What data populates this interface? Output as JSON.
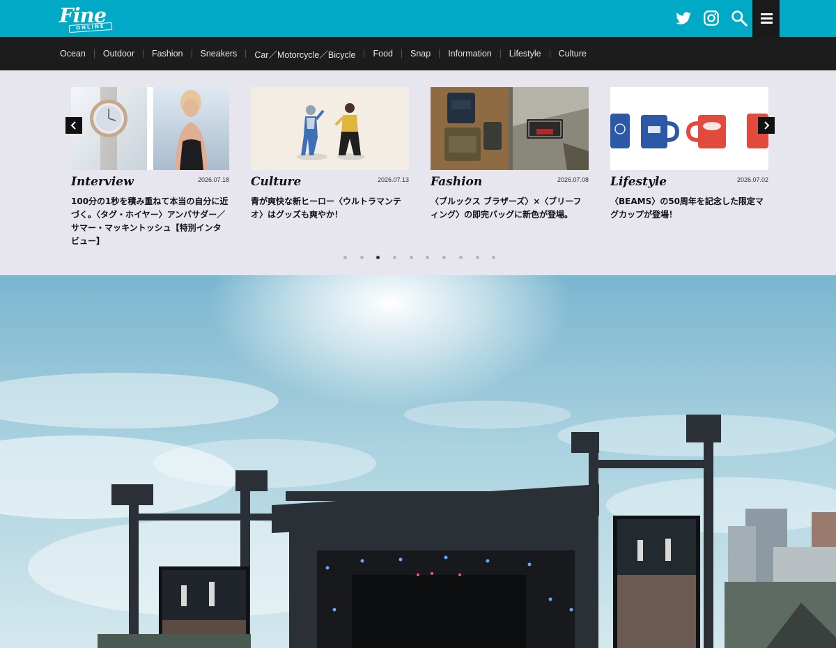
{
  "header": {
    "logo_text": "Fine",
    "logo_sub": "ONLINE",
    "icons": [
      "twitter-icon",
      "instagram-icon",
      "search-icon",
      "menu-icon"
    ],
    "accent_color": "#00a9c6"
  },
  "nav": {
    "items": [
      {
        "label": "Ocean"
      },
      {
        "label": "Outdoor"
      },
      {
        "label": "Fashion"
      },
      {
        "label": "Sneakers"
      },
      {
        "label": "Car／Motorcycle／Bicycle"
      },
      {
        "label": "Food"
      },
      {
        "label": "Snap"
      },
      {
        "label": "Information"
      },
      {
        "label": "Lifestyle"
      },
      {
        "label": "Culture"
      }
    ]
  },
  "carousel": {
    "cards": [
      {
        "category": "Interview",
        "date": "2026.07.18",
        "title": "100分の1秒を積み重ねて本当の自分に近づく。〈タグ・ホイヤー〉アンバサダー／サマー・マッキントッシュ【特別インタビュー】"
      },
      {
        "category": "Culture",
        "date": "2026.07.13",
        "title": "青が爽快な新ヒーロー〈ウルトラマンテオ〉はグッズも爽やか！"
      },
      {
        "category": "Fashion",
        "date": "2026.07.08",
        "title": "〈ブルックス ブラザーズ〉×〈ブリーフィング〉の即完バッグに新色が登場。"
      },
      {
        "category": "Lifestyle",
        "date": "2026.07.02",
        "title": "〈BEAMS〉の50周年を記念した限定マグカップが登場！"
      }
    ],
    "pagination": {
      "total": 10,
      "active": 3
    }
  }
}
